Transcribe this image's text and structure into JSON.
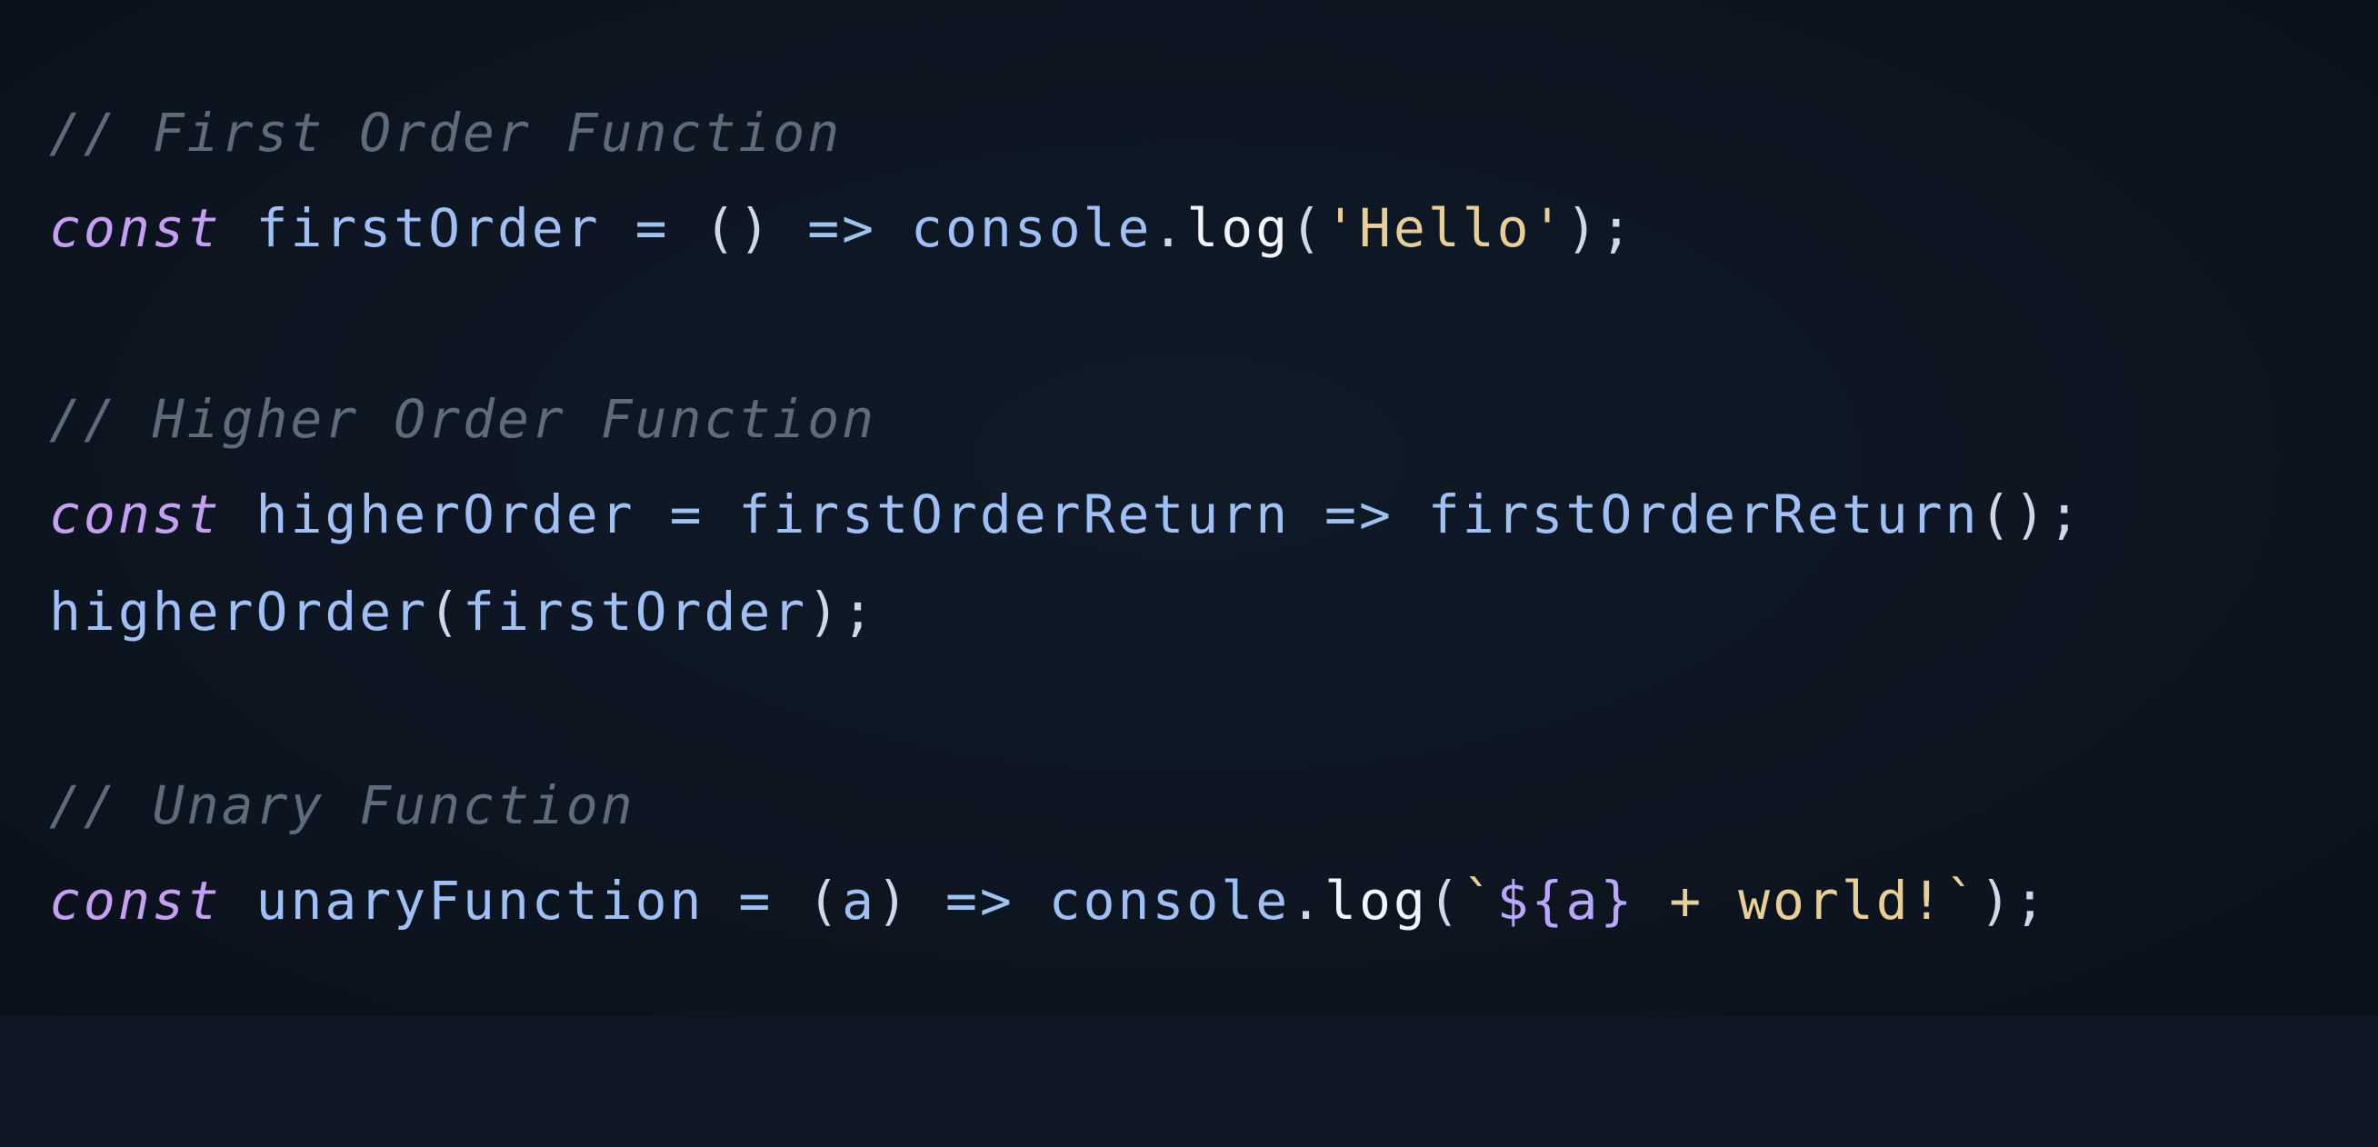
{
  "editor": {
    "background": "#0f1724",
    "colors": {
      "comment": "#5f6a7b",
      "keyword": "#c5a0f2",
      "identifier": "#a0c0f5",
      "operator": "#9fc3f0",
      "string": "#e8cf95"
    },
    "lines": {
      "l1": {
        "comment": "// First Order Function"
      },
      "l2": {
        "kw": "const",
        "name": "firstOrder",
        "eq": "=",
        "params": "()",
        "arrow": "=>",
        "obj": "console",
        "dot": ".",
        "method": "log",
        "open": "(",
        "string": "'Hello'",
        "close": ");"
      },
      "l4": {
        "comment": "// Higher Order Function"
      },
      "l5": {
        "kw": "const",
        "name": "higherOrder",
        "eq": "=",
        "param": "firstOrderReturn",
        "arrow": "=>",
        "call": "firstOrderReturn",
        "close": "();"
      },
      "l6": {
        "fn": "higherOrder",
        "open": "(",
        "arg": "firstOrder",
        "close": ");"
      },
      "l8": {
        "comment": "// Unary Function"
      },
      "l9": {
        "kw": "const",
        "name": "unaryFunction",
        "eq": "=",
        "open": "(",
        "param": "a",
        "close_paren": ")",
        "arrow": "=>",
        "obj": "console",
        "dot": ".",
        "method": "log",
        "open2": "(",
        "tick_open": "`",
        "interp": "${a}",
        "text": " + world!",
        "tick_close": "`",
        "close": ");"
      }
    }
  }
}
